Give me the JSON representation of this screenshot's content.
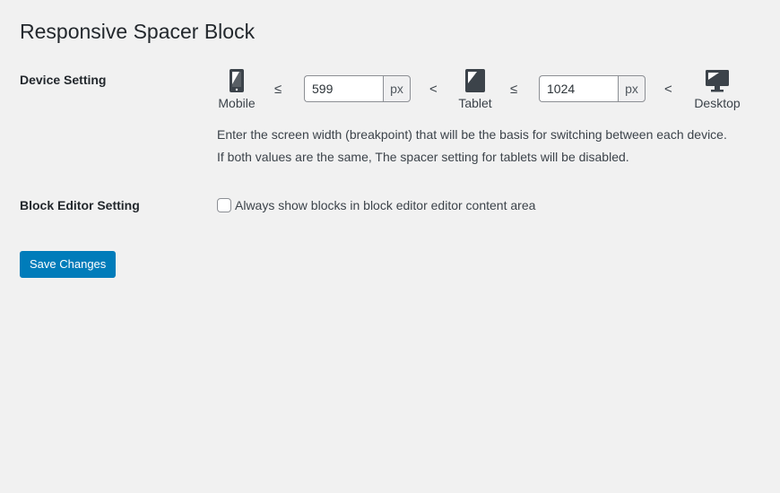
{
  "page": {
    "title": "Responsive Spacer Block"
  },
  "device_setting": {
    "label": "Device Setting",
    "devices": [
      {
        "name": "Mobile",
        "icon": "smartphone-icon"
      },
      {
        "name": "Tablet",
        "icon": "tablet-icon"
      },
      {
        "name": "Desktop",
        "icon": "desktop-icon"
      }
    ],
    "operators": [
      "≤",
      "<",
      "≤",
      "<"
    ],
    "mobile_breakpoint": {
      "value": "599",
      "unit": "px"
    },
    "tablet_breakpoint": {
      "value": "1024",
      "unit": "px"
    },
    "description_line1": "Enter the screen width (breakpoint) that will be the basis for switching between each device.",
    "description_line2": "If both values are the same, The spacer setting for tablets will be disabled."
  },
  "block_editor_setting": {
    "label": "Block Editor Setting",
    "checkbox_label": "Always show blocks in block editor editor content area",
    "checked": false
  },
  "actions": {
    "save_label": "Save Changes"
  },
  "colors": {
    "background": "#f1f1f1",
    "primary_button": "#007cba",
    "text": "#23282d"
  }
}
